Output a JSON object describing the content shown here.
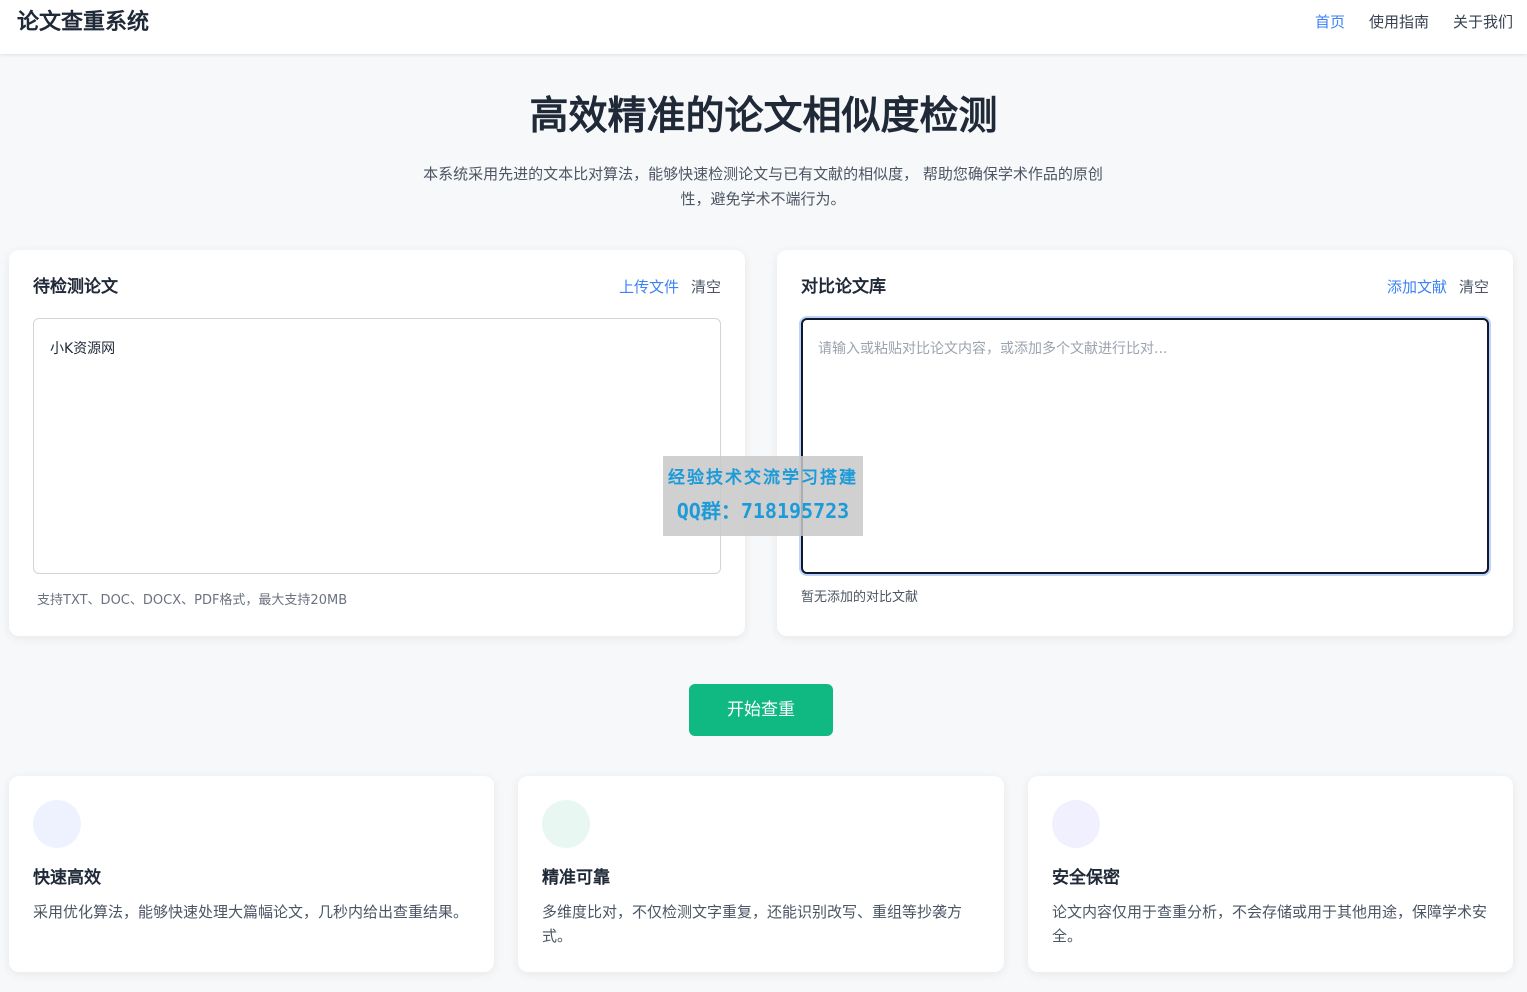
{
  "header": {
    "logo": "论文查重系统",
    "nav": [
      {
        "label": "首页",
        "active": true
      },
      {
        "label": "使用指南",
        "active": false
      },
      {
        "label": "关于我们",
        "active": false
      }
    ]
  },
  "hero": {
    "title": "高效精准的论文相似度检测",
    "description": "本系统采用先进的文本比对算法，能够快速检测论文与已有文献的相似度， 帮助您确保学术作品的原创性，避免学术不端行为。"
  },
  "left_card": {
    "title": "待检测论文",
    "upload_label": "上传文件",
    "clear_label": "清空",
    "content": "小K资源网",
    "hint": "支持TXT、DOC、DOCX、PDF格式，最大支持20MB"
  },
  "right_card": {
    "title": "对比论文库",
    "add_label": "添加文献",
    "clear_label": "清空",
    "placeholder": "请输入或粘贴对比论文内容，或添加多个文献进行比对...",
    "hint": "暂无添加的对比文献"
  },
  "start_button": "开始查重",
  "features": [
    {
      "title": "快速高效",
      "desc": "采用优化算法，能够快速处理大篇幅论文，几秒内给出查重结果。",
      "icon_color": "#eef2ff"
    },
    {
      "title": "精准可靠",
      "desc": "多维度比对，不仅检测文字重复，还能识别改写、重组等抄袭方式。",
      "icon_color": "#e8f7f1"
    },
    {
      "title": "安全保密",
      "desc": "论文内容仅用于查重分析，不会存储或用于其他用途，保障学术安全。",
      "icon_color": "#f1f0fe"
    }
  ],
  "watermark": {
    "line1": "经验技术交流学习搭建",
    "line2": "QQ群：718195723"
  },
  "colors": {
    "accent": "#3b82f6",
    "start_button": "#10b981",
    "watermark_text": "#1d9bd8"
  }
}
